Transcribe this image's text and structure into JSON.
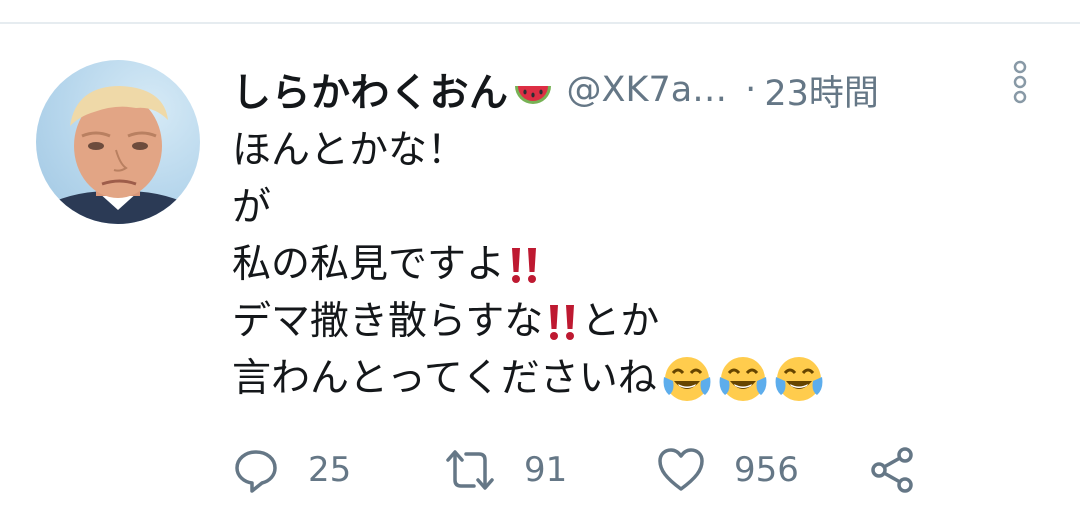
{
  "tweet": {
    "author": {
      "display_name": "しらかわくおん",
      "name_emoji": "watermelon-icon",
      "handle": "@XK7a…",
      "avatar": "profile-photo"
    },
    "separator": "·",
    "time": "23時間",
    "lines": [
      "ほんとかな！",
      "が",
      "私の私見ですよ",
      "デマ撒き散らすな",
      "とか",
      "言わんとってくださいね"
    ],
    "emojis": [
      "double-exclamation-icon",
      "tears-of-joy-icon"
    ],
    "actions": {
      "reply_count": "25",
      "retweet_count": "91",
      "like_count": "956"
    }
  },
  "colors": {
    "text": "#14171a",
    "secondary": "#657786",
    "divider": "#e6ecf0",
    "exclamation": "#be1931",
    "emoji_yellow": "#ffcc4d"
  }
}
